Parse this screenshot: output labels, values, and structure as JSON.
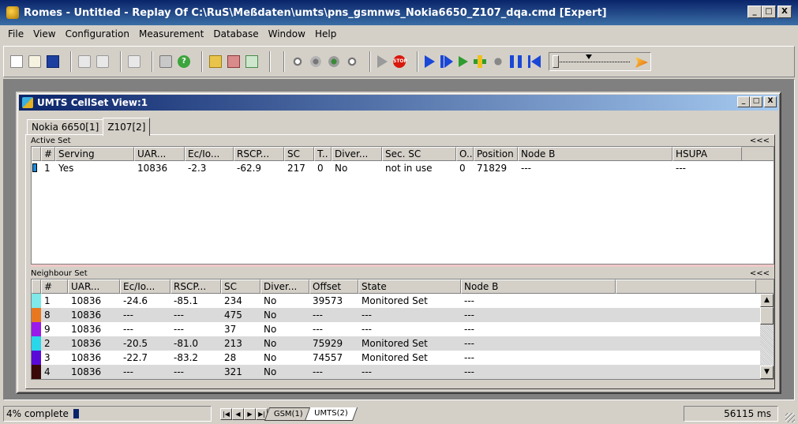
{
  "window": {
    "title": "Romes - Untitled - Replay Of C:\\RuS\\Meßdaten\\umts\\pns_gsmnws_Nokia6650_Z107_dqa.cmd [Expert]",
    "minimize": "_",
    "maximize": "□",
    "close": "X"
  },
  "menu": [
    "File",
    "View",
    "Configuration",
    "Measurement",
    "Database",
    "Window",
    "Help"
  ],
  "toolbar": {
    "buttons": [
      "new-icon",
      "open-icon",
      "save-icon",
      "copy-icon",
      "paste-icon",
      "export-icon",
      "print-icon",
      "help-icon",
      "database-icon",
      "database-delete-icon",
      "edit-icon",
      "connect-icon",
      "settings-icon",
      "settings-green-icon",
      "scope-icon",
      "record-icon",
      "stop-icon",
      "play-icon",
      "step-icon",
      "forward-icon",
      "jump-icon",
      "bug-icon",
      "pause-icon",
      "rewind-icon"
    ],
    "slider_level": 0
  },
  "child_window": {
    "title": "UMTS CellSet View:1",
    "tabs": [
      "Nokia 6650[1]",
      "Z107[2]"
    ],
    "active_tab": 1
  },
  "active_set": {
    "caption": "Active Set",
    "collapse": "<<<",
    "columns": [
      "",
      "#",
      "Serving",
      "UAR...",
      "Ec/Io...",
      "RSCP...",
      "SC",
      "T..",
      "Diver...",
      "Sec. SC",
      "O..",
      "Position",
      "Node B",
      "HSUPA"
    ],
    "rows": [
      {
        "num": "1",
        "serving": "Yes",
        "uarfcn": "10836",
        "ecio": "-2.3",
        "rscp": "-62.9",
        "sc": "217",
        "t": "0",
        "diversity": "No",
        "sec_sc": "not in use",
        "o": "0",
        "position": "71829",
        "node_b": "---",
        "hsupa": "---"
      }
    ]
  },
  "neighbour_set": {
    "caption": "Neighbour Set",
    "collapse": "<<<",
    "columns": [
      "",
      "#",
      "UAR...",
      "Ec/Io...",
      "RSCP...",
      "SC",
      "Diver...",
      "Offset",
      "State",
      "Node B",
      ""
    ],
    "rows": [
      {
        "color": "#7fe8e8",
        "num": "1",
        "uarfcn": "10836",
        "ecio": "-24.6",
        "rscp": "-85.1",
        "sc": "234",
        "diversity": "No",
        "offset": "39573",
        "state": "Monitored Set",
        "node_b": "---"
      },
      {
        "color": "#e87820",
        "num": "8",
        "uarfcn": "10836",
        "ecio": "---",
        "rscp": "---",
        "sc": "475",
        "diversity": "No",
        "offset": "---",
        "state": "---",
        "node_b": "---"
      },
      {
        "color": "#9a1aea",
        "num": "9",
        "uarfcn": "10836",
        "ecio": "---",
        "rscp": "---",
        "sc": "37",
        "diversity": "No",
        "offset": "---",
        "state": "---",
        "node_b": "---"
      },
      {
        "color": "#2ad6ea",
        "num": "2",
        "uarfcn": "10836",
        "ecio": "-20.5",
        "rscp": "-81.0",
        "sc": "213",
        "diversity": "No",
        "offset": "75929",
        "state": "Monitored Set",
        "node_b": "---"
      },
      {
        "color": "#5a0ad8",
        "num": "3",
        "uarfcn": "10836",
        "ecio": "-22.7",
        "rscp": "-83.2",
        "sc": "28",
        "diversity": "No",
        "offset": "74557",
        "state": "Monitored Set",
        "node_b": "---"
      },
      {
        "color": "#3a0808",
        "num": "4",
        "uarfcn": "10836",
        "ecio": "---",
        "rscp": "---",
        "sc": "321",
        "diversity": "No",
        "offset": "---",
        "state": "---",
        "node_b": "---"
      }
    ]
  },
  "statusbar": {
    "progress_text": "4% complete",
    "progress_fraction": 0.04,
    "sheet_tabs": [
      "GSM(1)",
      "UMTS(2)"
    ],
    "active_sheet": 1,
    "time": "56115 ms"
  }
}
